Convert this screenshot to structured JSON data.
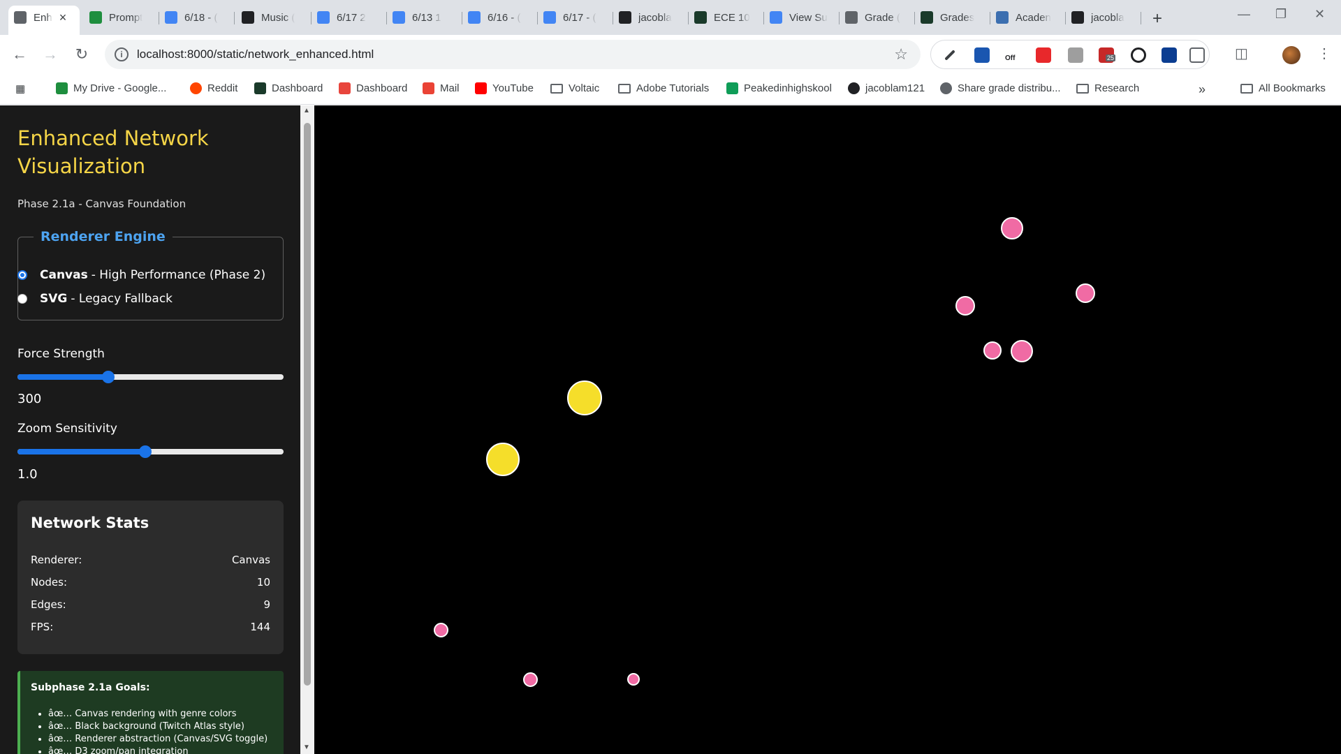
{
  "browser": {
    "tabs": [
      {
        "title": "Enh",
        "icon": "chrome-page-icon",
        "color": "#5f6368",
        "active": true
      },
      {
        "title": "Prompt",
        "icon": "google-drive-icon",
        "color": "#1e8e3e"
      },
      {
        "title": "6/18 - (",
        "icon": "google-docs-icon",
        "color": "#4285f4"
      },
      {
        "title": "Music (",
        "icon": "openai-icon",
        "color": "#202124"
      },
      {
        "title": "6/17 2",
        "icon": "google-docs-icon",
        "color": "#4285f4"
      },
      {
        "title": "6/13 1",
        "icon": "google-docs-icon",
        "color": "#4285f4"
      },
      {
        "title": "6/16 - (",
        "icon": "google-docs-icon",
        "color": "#4285f4"
      },
      {
        "title": "6/17 - (",
        "icon": "google-docs-icon",
        "color": "#4285f4"
      },
      {
        "title": "jacobla",
        "icon": "github-icon",
        "color": "#202124"
      },
      {
        "title": "ECE 10",
        "icon": "purdue-icon",
        "color": "#1a3a2a"
      },
      {
        "title": "View Su",
        "icon": "bar-chart-icon",
        "color": "#4285f4"
      },
      {
        "title": "Grade (",
        "icon": "calculator-icon",
        "color": "#5f6368"
      },
      {
        "title": "Grades",
        "icon": "purdue-icon",
        "color": "#1a3a2a"
      },
      {
        "title": "Acaden",
        "icon": "graduation-cap-icon",
        "color": "#3c6fb0"
      },
      {
        "title": "jacobla",
        "icon": "github-icon",
        "color": "#202124"
      }
    ],
    "url": "localhost:8000/static/network_enhanced.html",
    "bookmarks": [
      {
        "label": "My Drive - Google...",
        "icon": "google-drive-icon",
        "color": "#1e8e3e"
      },
      {
        "label": "Reddit",
        "icon": "reddit-icon",
        "color": "#ff4500"
      },
      {
        "label": "Dashboard",
        "icon": "purdue-icon",
        "color": "#1a3a2a"
      },
      {
        "label": "Dashboard",
        "icon": "brightspace-icon",
        "color": "#e8453c"
      },
      {
        "label": "Mail",
        "icon": "gmail-icon",
        "color": "#ea4335"
      },
      {
        "label": "YouTube",
        "icon": "youtube-icon",
        "color": "#ff0000"
      },
      {
        "label": "Voltaic",
        "icon": "folder-icon",
        "color": "#5f6368"
      },
      {
        "label": "Adobe Tutorials",
        "icon": "folder-icon",
        "color": "#5f6368"
      },
      {
        "label": "Peakedinhighskool",
        "icon": "google-sheets-icon",
        "color": "#0f9d58"
      },
      {
        "label": "jacoblam121",
        "icon": "github-icon",
        "color": "#202124"
      },
      {
        "label": "Share grade distribu...",
        "icon": "globe-icon",
        "color": "#5f6368"
      },
      {
        "label": "Research",
        "icon": "folder-icon",
        "color": "#5f6368"
      }
    ],
    "all_bookmarks": "All Bookmarks",
    "extension_badge": "25",
    "extension_off_label": "Off"
  },
  "sidebar": {
    "title": "Enhanced Network Visualization",
    "subtitle": "Phase 2.1a - Canvas Foundation",
    "renderer": {
      "legend": "Renderer Engine",
      "options": [
        {
          "name": "Canvas",
          "desc": "- High Performance (Phase 2)",
          "checked": true
        },
        {
          "name": "SVG",
          "desc": "- Legacy Fallback",
          "checked": false
        }
      ]
    },
    "force": {
      "label": "Force Strength",
      "value": "300",
      "fraction": 0.34
    },
    "zoom": {
      "label": "Zoom Sensitivity",
      "value": "1.0",
      "fraction": 0.48
    },
    "stats": {
      "title": "Network Stats",
      "rows": [
        {
          "label": "Renderer:",
          "value": "Canvas"
        },
        {
          "label": "Nodes:",
          "value": "10"
        },
        {
          "label": "Edges:",
          "value": "9"
        },
        {
          "label": "FPS:",
          "value": "144"
        }
      ]
    },
    "goals": {
      "title": "Subphase 2.1a Goals:",
      "items": [
        "âœ… Canvas rendering with genre colors",
        "âœ… Black background (Twitch Atlas style)",
        "âœ… Renderer abstraction (Canvas/SVG toggle)",
        "âœ… D3 zoom/pan integration"
      ]
    }
  },
  "colors": {
    "title": "#f5d547",
    "legend": "#4da3f0",
    "node_pink": "#f06ba4",
    "node_yellow": "#f5de2a",
    "accent": "#1a73e8"
  }
}
